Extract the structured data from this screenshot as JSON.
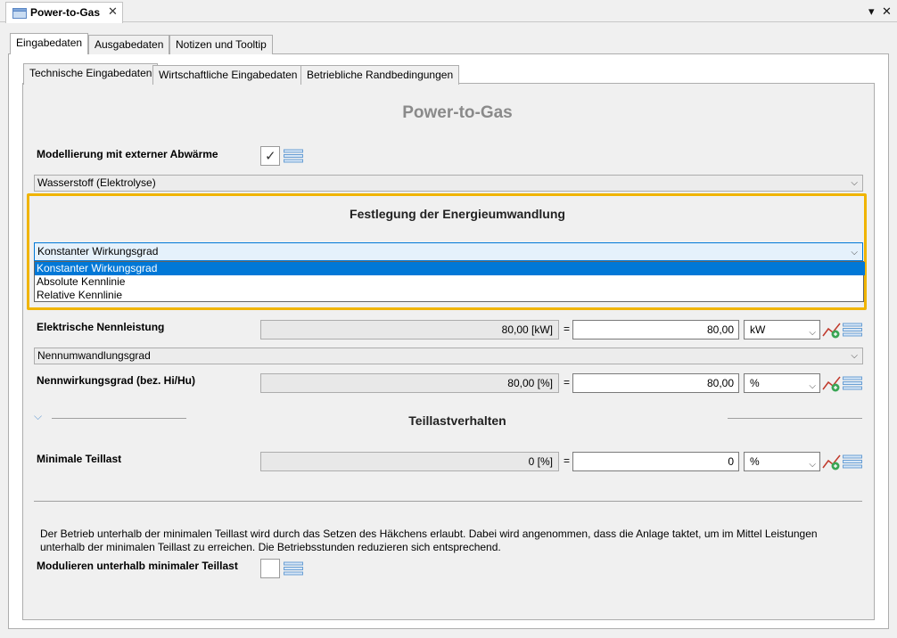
{
  "window": {
    "tab_title": "Power-to-Gas",
    "close_glyph": "✕",
    "pin_glyph": "▾",
    "window_close_glyph": "✕"
  },
  "outer_tabs": [
    "Eingabedaten",
    "Ausgabedaten",
    "Notizen und Tooltip"
  ],
  "inner_tabs": [
    "Technische Eingabedaten",
    "Wirtschaftliche Eingabedaten",
    "Betriebliche Randbedingungen"
  ],
  "page_title": "Power-to-Gas",
  "external_heat": {
    "label": "Modellierung mit externer Abwärme",
    "checked": true,
    "check_glyph": "✓"
  },
  "technology_select": "Wasserstoff (Elektrolyse)",
  "conversion": {
    "title": "Festlegung der Energieumwandlung",
    "selected": "Konstanter Wirkungsgrad",
    "options": [
      "Konstanter Wirkungsgrad",
      "Absolute Kennlinie",
      "Relative Kennlinie"
    ]
  },
  "nominal_power": {
    "label": "Elektrische Nennleistung",
    "computed": "80,00 [kW]",
    "equals": "=",
    "value": "80,00",
    "unit": "kW"
  },
  "efficiency_select": "Nennumwandlungsgrad",
  "nominal_efficiency": {
    "label": "Nennwirkungsgrad (bez. Hi/Hu)",
    "computed": "80,00 [%]",
    "equals": "=",
    "value": "80,00",
    "unit": "%"
  },
  "partload": {
    "title": "Teillastverhalten",
    "min_label": "Minimale Teillast",
    "computed": "0 [%]",
    "equals": "=",
    "value": "0",
    "unit": "%",
    "info_text": "Der Betrieb unterhalb der minimalen Teillast wird durch das Setzen des Häkchens erlaubt. Dabei wird angenommen, dass die Anlage taktet, um im Mittel Leistungen unterhalb der minimalen Teillast zu erreichen. Die Betriebsstunden reduzieren sich entsprechend.",
    "modulate_label": "Modulieren unterhalb minimaler Teillast",
    "modulate_checked": false
  },
  "icons": {
    "chevron": "⌵",
    "collapse": "⌵"
  },
  "colors": {
    "highlight": "#f0b400",
    "selection": "#0078d7",
    "title_gray": "#8a8a8a"
  }
}
